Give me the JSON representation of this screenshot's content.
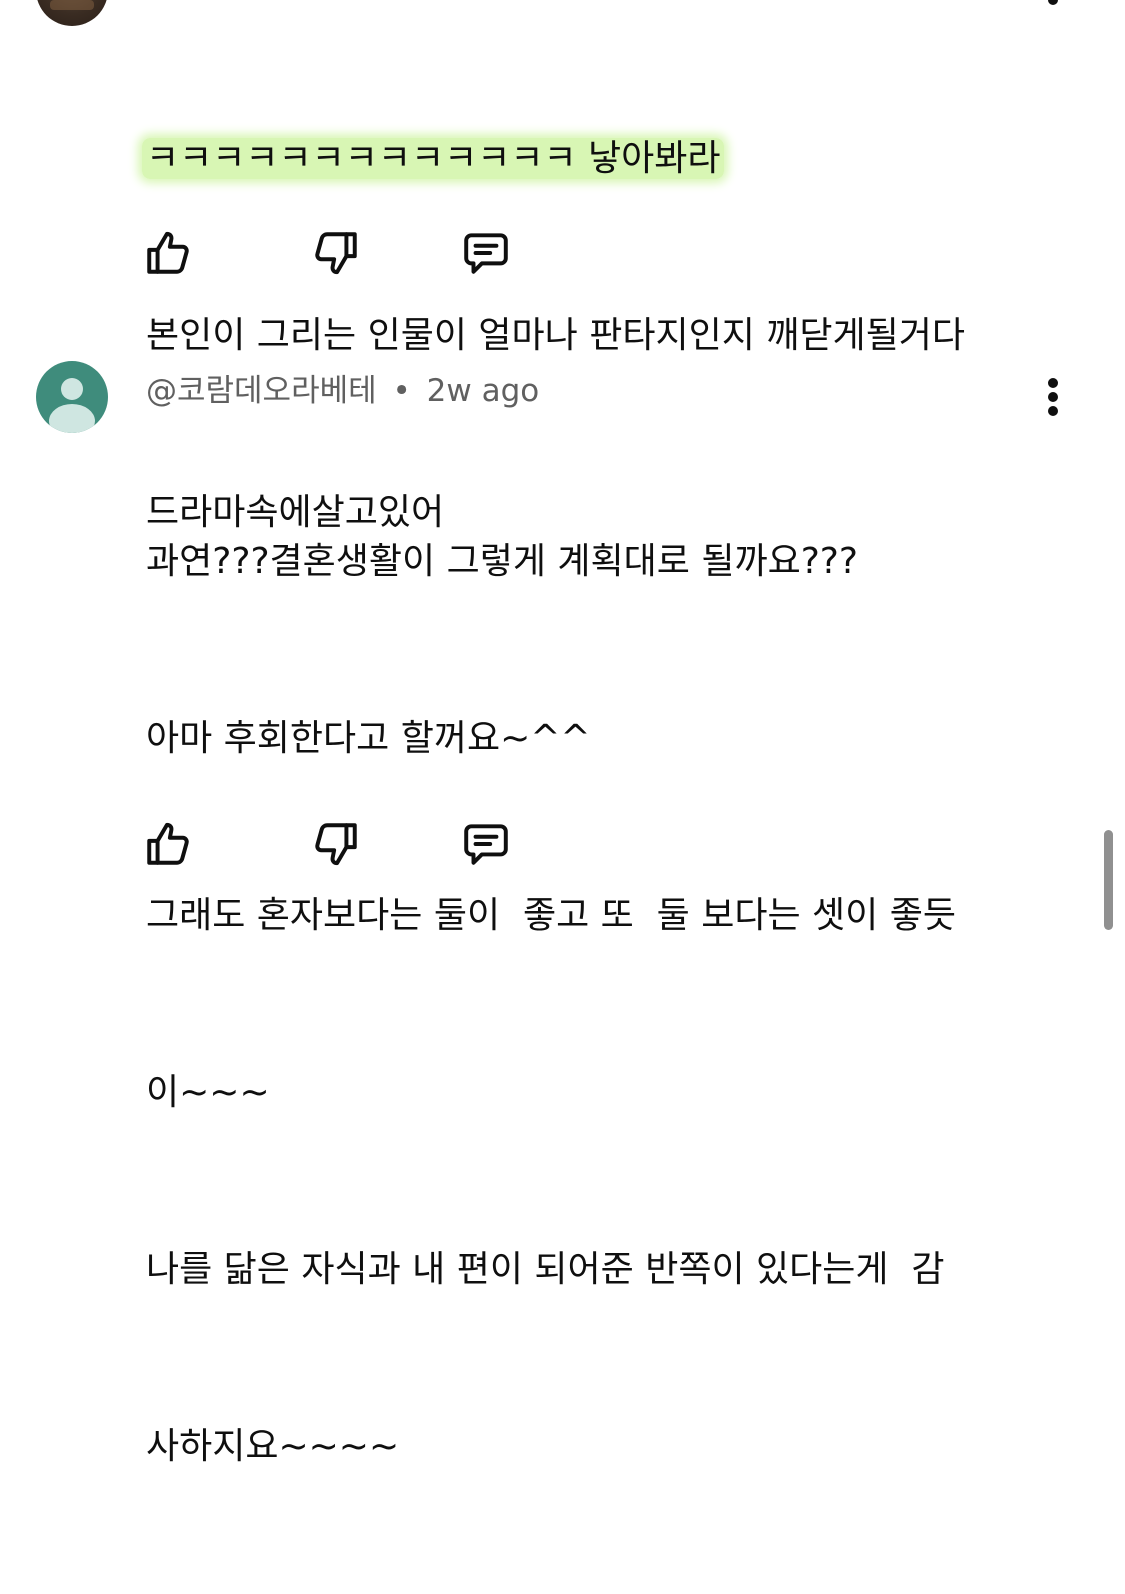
{
  "comments": [
    {
      "lines": [
        "ㅋㅋㅋㅋㅋㅋㅋㅋㅋㅋㅋㅋㅋ 낳아봐라",
        "본인이 그리는 인물이 얼마나 판타지인지 깨닫게될거다",
        "드라마속에살고있어"
      ],
      "highlight_color": "#d8f6b4"
    },
    {
      "author": "@코람데오라베테",
      "separator": "•",
      "time": "2w ago",
      "lines": [
        "과연???결혼생활이 그렇게 계획대로 될까요???",
        "아마 후회한다고 할꺼요~^^",
        "그래도 혼자보다는 둘이  좋고 또  둘 보다는 셋이 좋듯",
        "이~~~",
        "나를 닮은 자식과 내 편이 되어준 반쪽이 있다는게  감",
        "사하지요~~~~"
      ],
      "avatar_color": "#3f8c7c"
    }
  ],
  "icons": {
    "like": "thumbs-up-icon",
    "dislike": "thumbs-down-icon",
    "reply": "reply-icon",
    "more": "more-vert-icon"
  }
}
